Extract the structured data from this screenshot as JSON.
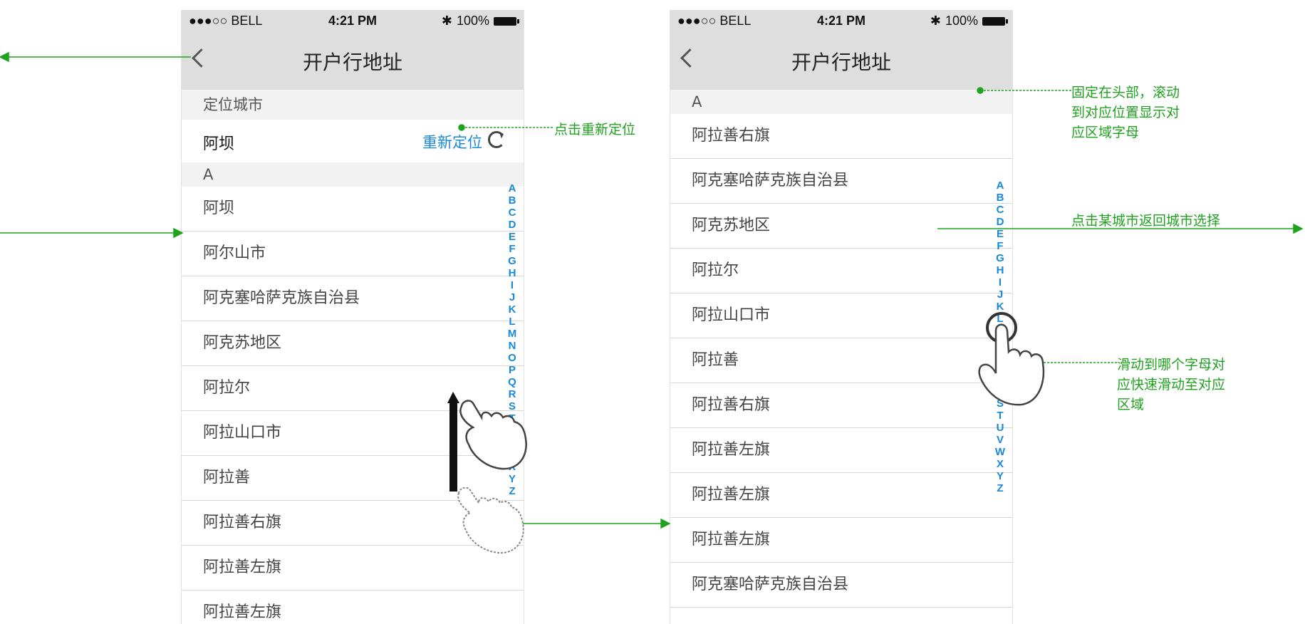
{
  "status_bar": {
    "carrier": "●●●○○ BELL",
    "time": "4:21 PM",
    "battery": "100%"
  },
  "nav": {
    "title": "开户行地址"
  },
  "screen1": {
    "location_header": "定位城市",
    "current_city": "阿坝",
    "relocate_label": "重新定位",
    "section_letter": "A",
    "cities": [
      "阿坝",
      "阿尔山市",
      "阿克塞哈萨克族自治县",
      "阿克苏地区",
      "阿拉尔",
      "阿拉山口市",
      "阿拉善",
      "阿拉善右旗",
      "阿拉善左旗",
      "阿拉善左旗"
    ]
  },
  "screen2": {
    "section_letter": "A",
    "cities": [
      "阿拉善右旗",
      "阿克塞哈萨克族自治县",
      "阿克苏地区",
      "阿拉尔",
      "阿拉山口市",
      "阿拉善",
      "阿拉善右旗",
      "阿拉善左旗",
      "阿拉善左旗",
      "阿拉善左旗",
      "阿克塞哈萨克族自治县"
    ]
  },
  "index_letters": [
    "A",
    "B",
    "C",
    "D",
    "E",
    "F",
    "G",
    "H",
    "I",
    "J",
    "K",
    "L",
    "M",
    "N",
    "O",
    "P",
    "Q",
    "R",
    "S",
    "T",
    "U",
    "V",
    "W",
    "X",
    "Y",
    "Z"
  ],
  "annotations": {
    "relocate": "点击重新定位",
    "sticky_header": [
      "固定在头部，滚动",
      "到对应位置显示对",
      "应区域字母"
    ],
    "tap_city": "点击某城市返回城市选择",
    "slide_index": [
      "滑动到哪个字母对",
      "应快速滑动至对应",
      "区域"
    ]
  },
  "colors": {
    "annotation": "#1fa31f",
    "index": "#1a88d8",
    "nav_bg": "#dedede"
  },
  "icons": [
    "back-chevron-icon",
    "refresh-icon",
    "bluetooth-icon",
    "wifi-icon",
    "battery-icon",
    "hand-pointer-icon"
  ]
}
